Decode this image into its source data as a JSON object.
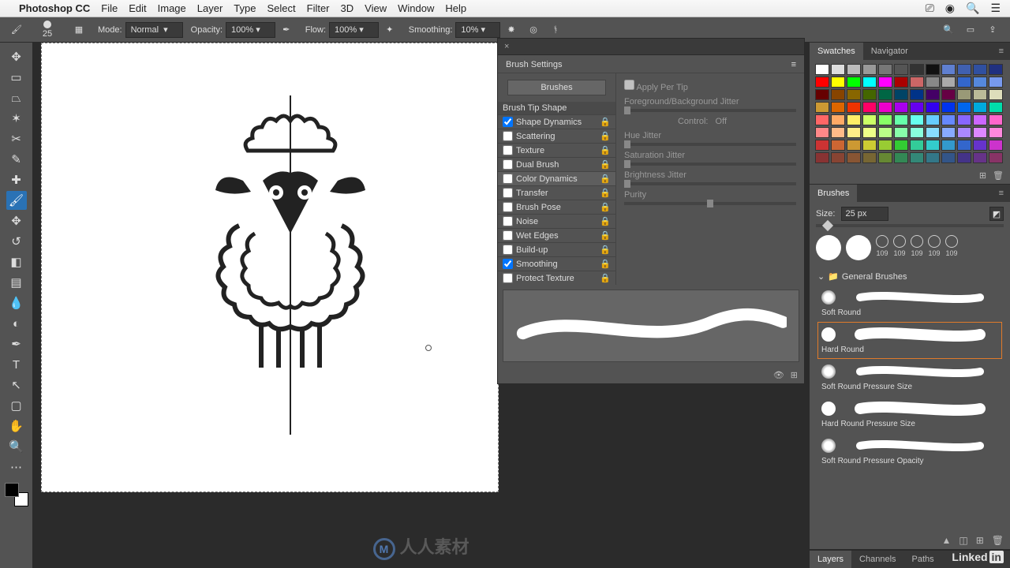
{
  "menubar": {
    "app": "Photoshop CC",
    "items": [
      "File",
      "Edit",
      "Image",
      "Layer",
      "Type",
      "Select",
      "Filter",
      "3D",
      "View",
      "Window",
      "Help"
    ]
  },
  "options": {
    "brush_size": "25",
    "mode_label": "Mode:",
    "mode_value": "Normal",
    "opacity_label": "Opacity:",
    "opacity_value": "100%",
    "flow_label": "Flow:",
    "flow_value": "100%",
    "smoothing_label": "Smoothing:",
    "smoothing_value": "10%"
  },
  "brush_settings": {
    "title": "Brush Settings",
    "brushes_btn": "Brushes",
    "apply_per_tip": "Apply Per Tip",
    "fg_bg_jitter": "Foreground/Background Jitter",
    "control_label": "Control:",
    "control_value": "Off",
    "hue_jitter": "Hue Jitter",
    "saturation_jitter": "Saturation Jitter",
    "brightness_jitter": "Brightness Jitter",
    "purity": "Purity",
    "list": [
      {
        "label": "Brush Tip Shape",
        "checked": null,
        "head": true
      },
      {
        "label": "Shape Dynamics",
        "checked": true
      },
      {
        "label": "Scattering",
        "checked": false
      },
      {
        "label": "Texture",
        "checked": false
      },
      {
        "label": "Dual Brush",
        "checked": false
      },
      {
        "label": "Color Dynamics",
        "checked": false,
        "selected": true
      },
      {
        "label": "Transfer",
        "checked": false
      },
      {
        "label": "Brush Pose",
        "checked": false
      },
      {
        "label": "Noise",
        "checked": false
      },
      {
        "label": "Wet Edges",
        "checked": false
      },
      {
        "label": "Build-up",
        "checked": false
      },
      {
        "label": "Smoothing",
        "checked": true
      },
      {
        "label": "Protect Texture",
        "checked": false
      }
    ]
  },
  "swatches": {
    "tabs": [
      "Swatches",
      "Navigator"
    ],
    "colors": [
      "#ffffff",
      "#dddddd",
      "#bbbbbb",
      "#999999",
      "#777777",
      "#555555",
      "#333333",
      "#111111",
      "#5f7fcf",
      "#4060b0",
      "#3050a0",
      "#203080",
      "#ff0000",
      "#ffff00",
      "#00ff00",
      "#00ffff",
      "#ff00ff",
      "#aa0000",
      "#cc6666",
      "#888888",
      "#aaaaaa",
      "#3366cc",
      "#5588dd",
      "#7799ee",
      "#660000",
      "#884400",
      "#886600",
      "#446600",
      "#006644",
      "#004466",
      "#003388",
      "#440066",
      "#660044",
      "#999977",
      "#bbbb99",
      "#ddddbb",
      "#cc9933",
      "#dd6600",
      "#ee3300",
      "#ff0066",
      "#ee00cc",
      "#aa00ee",
      "#6600ee",
      "#3300ee",
      "#0033ee",
      "#0066ee",
      "#00aadd",
      "#00ddaa",
      "#ff6666",
      "#ffaa66",
      "#ffee66",
      "#ccff66",
      "#88ff66",
      "#66ffaa",
      "#66ffee",
      "#66ccff",
      "#6688ff",
      "#8866ff",
      "#cc66ff",
      "#ff66cc",
      "#ff8888",
      "#ffbb88",
      "#ffee88",
      "#eeff88",
      "#bbff88",
      "#88ffaa",
      "#88ffdd",
      "#88ddff",
      "#88aaff",
      "#aa88ff",
      "#dd88ff",
      "#ff88dd",
      "#cc3333",
      "#cc6633",
      "#cc9933",
      "#cccc33",
      "#99cc33",
      "#33cc33",
      "#33cc99",
      "#33cccc",
      "#3399cc",
      "#3366cc",
      "#6633cc",
      "#cc33cc",
      "#883333",
      "#884433",
      "#885533",
      "#776633",
      "#668833",
      "#338855",
      "#338877",
      "#337788",
      "#335588",
      "#443388",
      "#663388",
      "#883366"
    ]
  },
  "brushes_panel": {
    "tab": "Brushes",
    "size_label": "Size:",
    "size_value": "25 px",
    "presets": [
      "",
      "",
      "109",
      "109",
      "109",
      "109",
      "109"
    ],
    "folder": "General Brushes",
    "items": [
      "Soft Round",
      "Hard Round",
      "Soft Round Pressure Size",
      "Hard Round Pressure Size",
      "Soft Round Pressure Opacity"
    ]
  },
  "bottom_tabs": [
    "Layers",
    "Channels",
    "Paths"
  ],
  "watermark": "人人素材"
}
